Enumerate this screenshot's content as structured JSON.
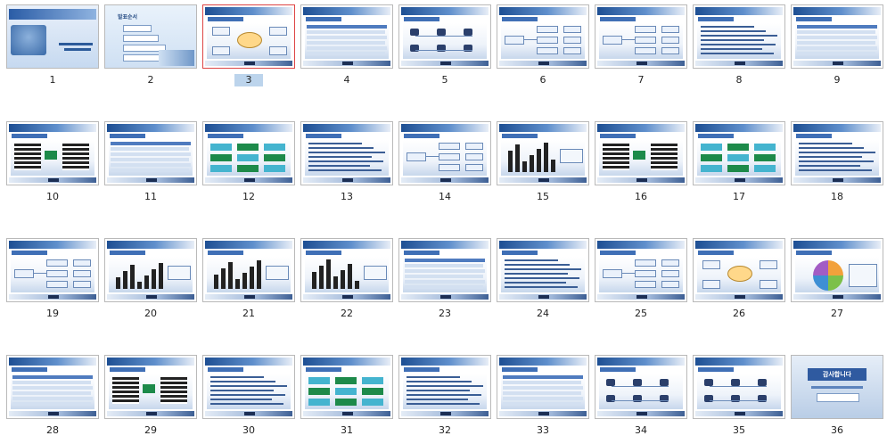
{
  "slides": [
    {
      "n": "1",
      "kind": "title"
    },
    {
      "n": "2",
      "kind": "contents",
      "title": "발표순서"
    },
    {
      "n": "3",
      "kind": "diagram",
      "selected": true
    },
    {
      "n": "4",
      "kind": "table"
    },
    {
      "n": "5",
      "kind": "network"
    },
    {
      "n": "6",
      "kind": "tree"
    },
    {
      "n": "7",
      "kind": "tree"
    },
    {
      "n": "8",
      "kind": "text"
    },
    {
      "n": "9",
      "kind": "table"
    },
    {
      "n": "10",
      "kind": "mixed"
    },
    {
      "n": "11",
      "kind": "table"
    },
    {
      "n": "12",
      "kind": "boxes"
    },
    {
      "n": "13",
      "kind": "text"
    },
    {
      "n": "14",
      "kind": "tree"
    },
    {
      "n": "15",
      "kind": "chart"
    },
    {
      "n": "16",
      "kind": "mixed"
    },
    {
      "n": "17",
      "kind": "boxes"
    },
    {
      "n": "18",
      "kind": "text"
    },
    {
      "n": "19",
      "kind": "tree"
    },
    {
      "n": "20",
      "kind": "chart"
    },
    {
      "n": "21",
      "kind": "chart"
    },
    {
      "n": "22",
      "kind": "chart"
    },
    {
      "n": "23",
      "kind": "table"
    },
    {
      "n": "24",
      "kind": "text"
    },
    {
      "n": "25",
      "kind": "tree"
    },
    {
      "n": "26",
      "kind": "diagram"
    },
    {
      "n": "27",
      "kind": "cycle"
    },
    {
      "n": "28",
      "kind": "table"
    },
    {
      "n": "29",
      "kind": "mixed"
    },
    {
      "n": "30",
      "kind": "text"
    },
    {
      "n": "31",
      "kind": "boxes"
    },
    {
      "n": "32",
      "kind": "text"
    },
    {
      "n": "33",
      "kind": "table"
    },
    {
      "n": "34",
      "kind": "network"
    },
    {
      "n": "35",
      "kind": "network"
    },
    {
      "n": "36",
      "kind": "end",
      "title": "감사합니다"
    }
  ],
  "colors": {
    "header": "#1e4f93",
    "selection_fill": "#bcd4ec",
    "selection_border": "#dd4444"
  }
}
